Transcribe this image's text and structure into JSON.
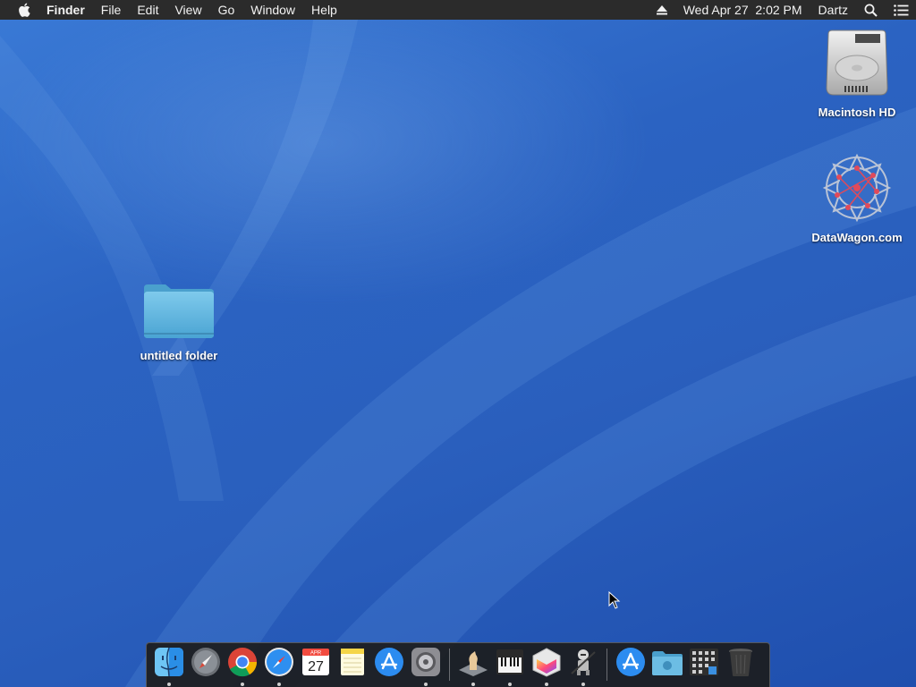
{
  "menubar": {
    "apple_icon": "apple-icon",
    "app_name": "Finder",
    "menus": [
      "File",
      "Edit",
      "View",
      "Go",
      "Window",
      "Help"
    ],
    "clock": "Wed Apr 27  2:02 PM",
    "user": "Dartz",
    "status_icons": [
      "eject-icon",
      "spotlight-search-icon",
      "notification-center-icon"
    ]
  },
  "desktop": {
    "icons": [
      {
        "label": "Macintosh HD",
        "icon": "hard-drive-icon"
      },
      {
        "label": "DataWagon.com",
        "icon": "network-volume-icon"
      },
      {
        "label": "untitled folder",
        "icon": "folder-icon"
      }
    ]
  },
  "dock": {
    "apps": [
      {
        "name": "Finder",
        "icon": "finder-icon",
        "running": true
      },
      {
        "name": "Launchpad",
        "icon": "launchpad-icon",
        "running": false
      },
      {
        "name": "Google Chrome",
        "icon": "chrome-icon",
        "running": true
      },
      {
        "name": "Safari",
        "icon": "safari-icon",
        "running": true
      },
      {
        "name": "Calendar",
        "icon": "calendar-icon",
        "running": false,
        "month": "APR",
        "day": "27"
      },
      {
        "name": "Notes",
        "icon": "notes-icon",
        "running": false
      },
      {
        "name": "App Store",
        "icon": "app-store-icon",
        "running": false
      },
      {
        "name": "System Preferences",
        "icon": "system-preferences-icon",
        "running": true
      },
      {
        "name": "Chess",
        "icon": "chess-icon",
        "running": true
      },
      {
        "name": "Piano",
        "icon": "piano-icon",
        "running": true
      },
      {
        "name": "Grapher",
        "icon": "grapher-icon",
        "running": true
      },
      {
        "name": "Automator",
        "icon": "automator-icon",
        "running": true
      }
    ],
    "others": [
      {
        "name": "Applications",
        "icon": "app-store-folder-icon"
      },
      {
        "name": "Downloads",
        "icon": "downloads-folder-icon"
      },
      {
        "name": "Launchpad Grid",
        "icon": "grid-folder-icon"
      },
      {
        "name": "Trash",
        "icon": "trash-icon"
      }
    ]
  },
  "colors": {
    "desktop": "#2b63c2",
    "menubar": "#2b2b2b",
    "dock": "#1c1c1c"
  }
}
